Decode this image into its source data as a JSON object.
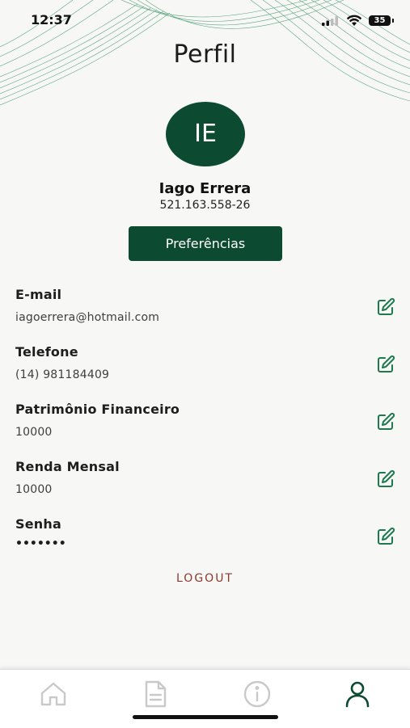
{
  "status_bar": {
    "time": "12:37",
    "battery": "35"
  },
  "header": {
    "title": "Perfil"
  },
  "profile": {
    "initials": "IE",
    "name": "Iago Errera",
    "cpf": "521.163.558-26",
    "preferences_label": "Preferências"
  },
  "fields": [
    {
      "label": "E-mail",
      "value": "iagoerrera@hotmail.com"
    },
    {
      "label": "Telefone",
      "value": "(14) 981184409"
    },
    {
      "label": "Patrimônio Financeiro",
      "value": "10000"
    },
    {
      "label": "Renda Mensal",
      "value": "10000"
    },
    {
      "label": "Senha",
      "value": "•••••••"
    }
  ],
  "logout_label": "LOGOUT",
  "tabs": [
    {
      "icon": "home-icon",
      "active": false
    },
    {
      "icon": "document-icon",
      "active": false
    },
    {
      "icon": "info-icon",
      "active": false
    },
    {
      "icon": "user-icon",
      "active": true
    }
  ],
  "colors": {
    "brand": "#0d4a32",
    "accent_edit": "#1e7a4e",
    "logout": "#8a3a2a",
    "inactive_tab": "#c9c9c9"
  }
}
